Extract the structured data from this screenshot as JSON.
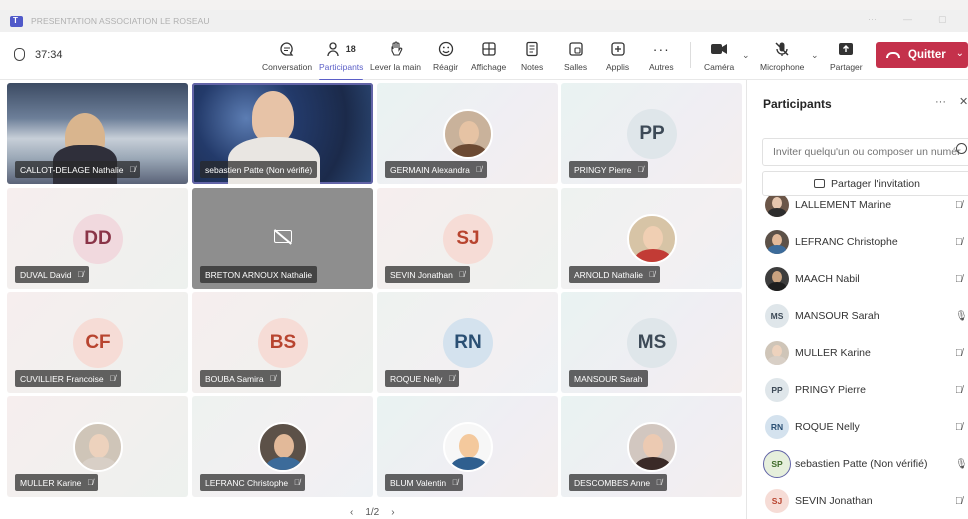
{
  "window": {
    "title": "PRESENTATION ASSOCIATION LE ROSEAU",
    "controls": [
      "···",
      "—",
      "▢"
    ]
  },
  "toolbar": {
    "timer": "37:34",
    "participant_count": "18",
    "buttons": {
      "conversation": "Conversation",
      "participants": "Participants",
      "raise_hand": "Lever la main",
      "react": "Réagir",
      "view": "Affichage",
      "notes": "Notes",
      "rooms": "Salles",
      "apps": "Applis",
      "more": "Autres",
      "camera": "Caméra",
      "microphone": "Microphone",
      "share": "Partager"
    },
    "quit_label": "Quitter",
    "accent_color": "#5b5fc7",
    "quit_color": "#c4314b"
  },
  "grid": {
    "tiles": [
      {
        "name": "CALLOT-DELAGE Nathalie"
      },
      {
        "name": "sebastien Patte (Non vérifié)"
      },
      {
        "name": "GERMAIN Alexandra"
      },
      {
        "name": "PRINGY Pierre",
        "initials": "PP"
      },
      {
        "name": "DUVAL David",
        "initials": "DD"
      },
      {
        "name": "BRETON ARNOUX Nathalie"
      },
      {
        "name": "SEVIN Jonathan",
        "initials": "SJ"
      },
      {
        "name": "ARNOLD Nathalie"
      },
      {
        "name": "CUVILLIER Francoise",
        "initials": "CF"
      },
      {
        "name": "BOUBA Samira",
        "initials": "BS"
      },
      {
        "name": "ROQUE Nelly",
        "initials": "RN"
      },
      {
        "name": "MANSOUR Sarah",
        "initials": "MS"
      },
      {
        "name": "MULLER Karine"
      },
      {
        "name": "LEFRANC Christophe"
      },
      {
        "name": "BLUM Valentin"
      },
      {
        "name": "DESCOMBES Anne"
      }
    ],
    "pager": {
      "prev": "‹",
      "label": "1/2",
      "next": "›"
    }
  },
  "panel": {
    "title": "Participants",
    "more": "···",
    "close": "✕",
    "invite_placeholder": "Inviter quelqu'un ou composer un numéro",
    "share_label": "Partager l'invitation",
    "participants": [
      {
        "name": "LALLEMENT Marine"
      },
      {
        "name": "LEFRANC Christophe"
      },
      {
        "name": "MAACH Nabil"
      },
      {
        "name": "MANSOUR Sarah",
        "initials": "MS"
      },
      {
        "name": "MULLER Karine"
      },
      {
        "name": "PRINGY Pierre",
        "initials": "PP"
      },
      {
        "name": "ROQUE Nelly",
        "initials": "RN"
      },
      {
        "name": "sebastien Patte (Non vérifié)",
        "initials": "SP"
      },
      {
        "name": "SEVIN Jonathan",
        "initials": "SJ"
      }
    ]
  }
}
